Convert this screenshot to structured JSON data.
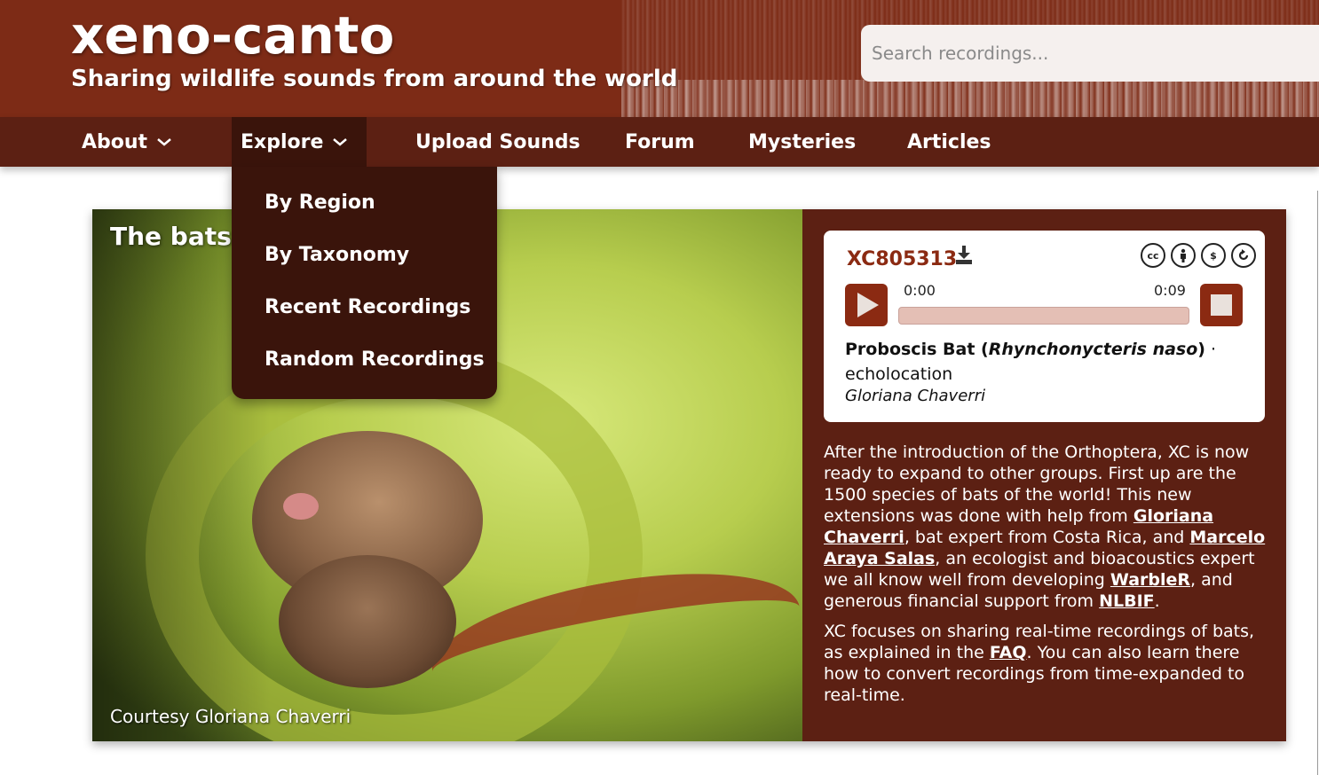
{
  "header": {
    "title": "xeno-canto",
    "tagline": "Sharing wildlife sounds from around the world",
    "search_placeholder": "Search recordings..."
  },
  "nav": {
    "items": [
      {
        "label": "About",
        "has_dropdown": true
      },
      {
        "label": "Explore",
        "has_dropdown": true,
        "active": true
      },
      {
        "label": "Upload Sounds"
      },
      {
        "label": "Forum"
      },
      {
        "label": "Mysteries"
      },
      {
        "label": "Articles"
      }
    ]
  },
  "explore_menu": {
    "items": [
      "By Region",
      "By Taxonomy",
      "Recent Recordings",
      "Random Recordings"
    ]
  },
  "feature": {
    "photo_title": "The bats a",
    "photo_credit": "Courtesy Gloriana Chaverri",
    "recording": {
      "id": "XC805313",
      "time_start": "0:00",
      "time_end": "0:09",
      "progress": 0.0,
      "common_name": "Proboscis Bat",
      "scientific_name": "Rhynchonycteris naso",
      "separator": "·",
      "sound_type": "echolocation",
      "recordist": "Gloriana Chaverri",
      "license_icons": [
        "cc-icon",
        "by-icon",
        "nc-icon",
        "sa-icon"
      ]
    },
    "description": {
      "p1_a": "After the introduction of the Orthoptera, XC is now ready to expand to other groups. First up are the 1500 species of bats of the world! This new extensions was done with help from ",
      "p1_link1": "Gloriana Chaverri",
      "p1_b": ", bat expert from Costa Rica, and ",
      "p1_link2": "Marcelo Araya Salas",
      "p1_c": ", an ecologist and bioacoustics expert we all know well from developing ",
      "p1_link3": "WarbleR",
      "p1_d": ", and generous financial support from ",
      "p1_link4": "NLBIF",
      "p1_e": ".",
      "p2_a": "XC focuses on sharing real-time recordings of bats, as explained in the ",
      "p2_link1": "FAQ",
      "p2_b": ". You can also learn there how to convert recordings from time-expanded to real-time."
    }
  },
  "colors": {
    "header": "#7d2b16",
    "nav": "#5c2013",
    "dropdown": "#3a140b",
    "accent": "#8b2a12"
  }
}
